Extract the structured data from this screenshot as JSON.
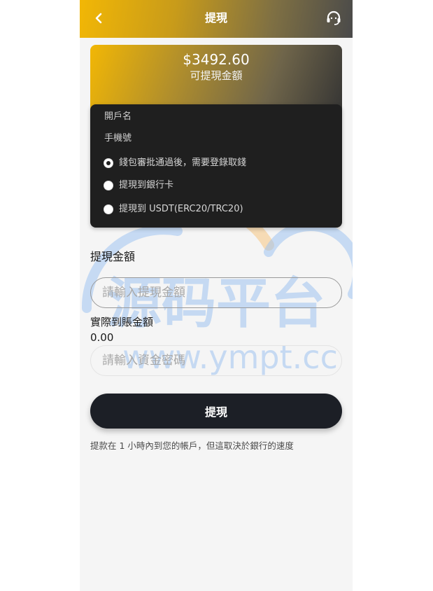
{
  "header": {
    "title": "提現",
    "back_icon": "chevron-left-icon",
    "support_icon": "headset-support-icon"
  },
  "balance": {
    "amount": "$3492.60",
    "label": "可提現金額"
  },
  "account": {
    "holder_label": "開戶名",
    "phone_label": "手機號"
  },
  "methods": [
    {
      "label": "錢包審批通過後，需要登錄取錢",
      "selected": true
    },
    {
      "label": "提現到銀行卡",
      "selected": false
    },
    {
      "label": "提現到 USDT(ERC20/TRC20)",
      "selected": false
    }
  ],
  "form": {
    "amount_label": "提現金額",
    "amount_placeholder": "請輸入提現金額",
    "actual_label": "實際到賬金額",
    "actual_value": "0.00",
    "password_placeholder": "請輸入資金密碼",
    "submit_label": "提現"
  },
  "note": "提款在 1 小時內到您的帳戶，但這取決於銀行的速度",
  "watermark": {
    "title": "源码平台",
    "url": "www.ympt.cc"
  },
  "colors": {
    "accent_gold": "#f2b705",
    "dark_panel": "#1f1f1f",
    "button_dark": "#1c1f26",
    "watermark_blue": "#9ec3f0",
    "watermark_orange": "#f7c98a"
  }
}
